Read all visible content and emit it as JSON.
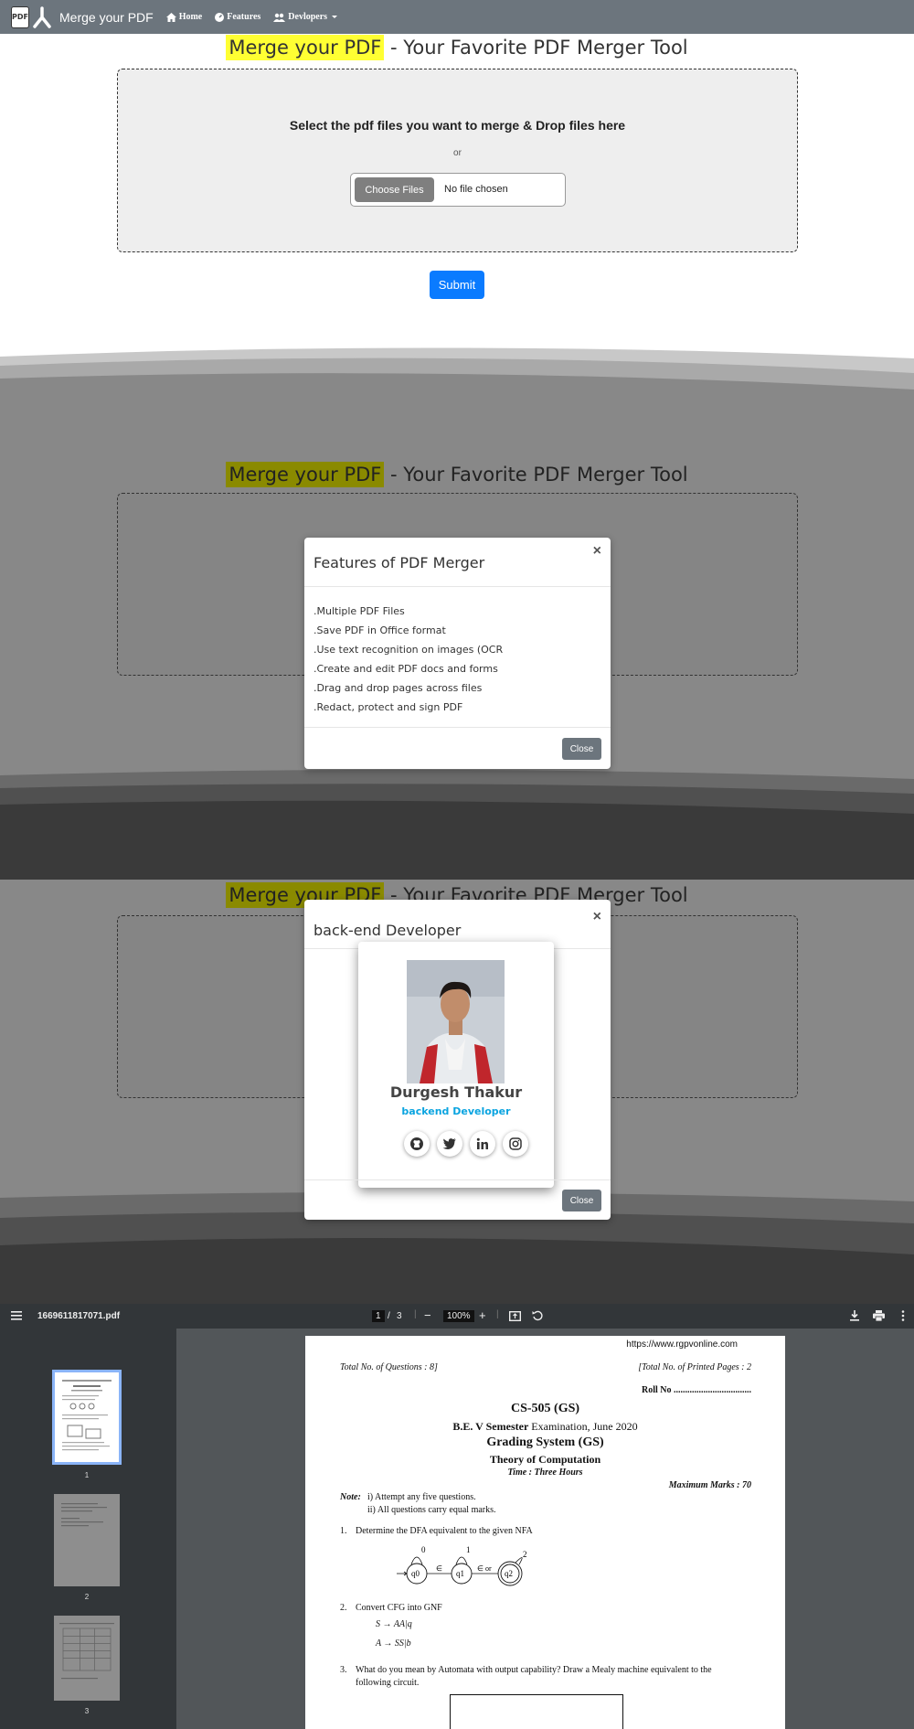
{
  "navbar": {
    "logo_text": "PDF",
    "brand": "Merge your PDF",
    "links": [
      "Home",
      "Features",
      "Devlopers"
    ]
  },
  "header": {
    "highlight": "Merge your PDF",
    "rest": " - Your Favorite PDF Merger Tool"
  },
  "upload": {
    "instruction": "Select the pdf files you want to merge & Drop files here",
    "or": "or",
    "choose_label": "Choose Files",
    "no_file": "No file chosen",
    "submit_label": "Submit"
  },
  "features_modal": {
    "title": "Features of PDF Merger",
    "close_x": "×",
    "items": [
      ".Multiple PDF Files",
      ".Save PDF in Office format",
      ".Use text recognition on images (OCR",
      ".Create and edit PDF docs and forms",
      ".Drag and drop pages across files",
      ".Redact, protect and sign PDF"
    ],
    "close_label": "Close"
  },
  "dev_modal": {
    "title": "back-end Developer",
    "close_x": "×",
    "name": "Durgesh Thakur",
    "role": "backend Developer",
    "socials": [
      "github-icon",
      "twitter-icon",
      "linkedin-icon",
      "instagram-icon"
    ],
    "close_label": "Close"
  },
  "pdf_viewer": {
    "filename": "1669611817071.pdf",
    "page_current": "1",
    "page_sep": "/",
    "page_total": "3",
    "zoom": "100%",
    "thumb_numbers": [
      "1",
      "2",
      "3"
    ],
    "page": {
      "url": "https://www.rgpvonline.com",
      "total_questions": "Total No. of Questions : 8]",
      "total_pages": "[Total No. of Printed Pages : 2",
      "roll_no": "Roll No ..................................",
      "code": "CS-505 (GS)",
      "semester": "B.E. V Semester",
      "exam": "Examination, June 2020",
      "system": "Grading System (GS)",
      "subject": "Theory of Computation",
      "time": "Time : Three Hours",
      "max_marks": "Maximum Marks : 70",
      "note_label": "Note:",
      "note1": "i)   Attempt any five questions.",
      "note2": "ii)  All questions carry equal marks.",
      "q1_num": "1.",
      "q1": "Determine the DFA equivalent to the given NFA",
      "q2_num": "2.",
      "q2": "Convert CFG into GNF",
      "q2_r1": "S → AA|q",
      "q2_r2": "A → SS|b",
      "q3_num": "3.",
      "q3_a": "What do you mean by Automata with output capability? Draw a Mealy machine equivalent to the",
      "q3_b": "following circuit.",
      "nfa_labels": [
        "0",
        "1",
        "2",
        "q0",
        "q1",
        "q2",
        "∈",
        "∈ or"
      ]
    }
  }
}
